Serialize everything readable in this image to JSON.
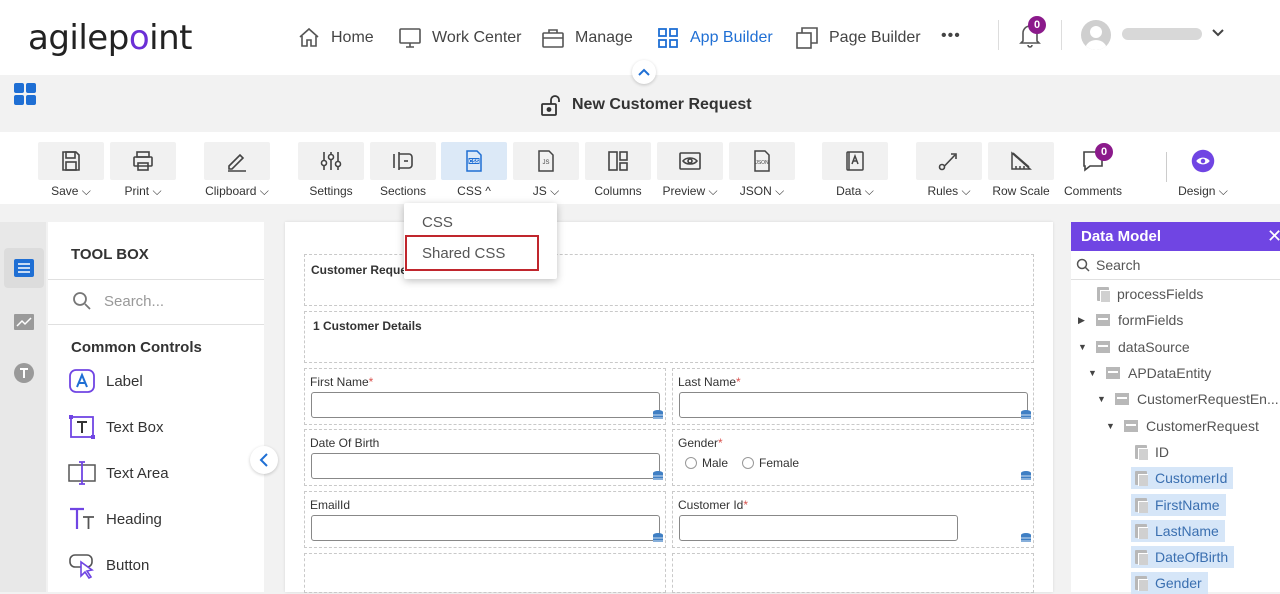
{
  "brand": {
    "logo_prefix": "agilep",
    "logo_o": "o",
    "logo_suffix": "int"
  },
  "nav": {
    "items": [
      {
        "label": "Home",
        "icon": "home-icon"
      },
      {
        "label": "Work Center",
        "icon": "monitor-icon"
      },
      {
        "label": "Manage",
        "icon": "briefcase-icon"
      },
      {
        "label": "App Builder",
        "icon": "grid-icon",
        "active": true
      },
      {
        "label": "Page Builder",
        "icon": "pages-icon"
      }
    ],
    "more": "•••",
    "notifications": "0"
  },
  "form": {
    "title": "New Customer Request"
  },
  "toolbar": {
    "save": "Save",
    "print": "Print",
    "clipboard": "Clipboard",
    "settings": "Settings",
    "sections": "Sections",
    "css": "CSS",
    "js": "JS",
    "columns": "Columns",
    "preview": "Preview",
    "json": "JSON",
    "data": "Data",
    "rules": "Rules",
    "row_scale": "Row Scale",
    "comments": "Comments",
    "comments_count": "0",
    "design": "Design"
  },
  "css_menu": {
    "items": [
      "CSS",
      "Shared CSS"
    ]
  },
  "toolbox": {
    "title": "TOOL BOX",
    "search_placeholder": "Search...",
    "group": "Common Controls",
    "items": [
      "Label",
      "Text Box",
      "Text Area",
      "Heading",
      "Button"
    ]
  },
  "canvas": {
    "section1": "Customer Request",
    "section2": "1 Customer Details",
    "fields": {
      "first_name": "First Name",
      "last_name": "Last Name",
      "dob": "Date Of Birth",
      "gender": "Gender",
      "email": "EmailId",
      "customer_id": "Customer Id",
      "required": "*"
    },
    "gender_options": [
      "Male",
      "Female"
    ]
  },
  "data_model": {
    "title": "Data Model",
    "search": "Search",
    "tree": [
      "processFields",
      "formFields",
      "dataSource",
      "APDataEntity",
      "CustomerRequestEn...",
      "CustomerRequest",
      "ID",
      "CustomerId",
      "FirstName",
      "LastName",
      "DateOfBirth",
      "Gender"
    ]
  },
  "colors": {
    "accent": "#1f6fd4",
    "panel_header": "#7045e3",
    "highlight_box": "#c0262d",
    "badge": "#8b1a8b"
  }
}
